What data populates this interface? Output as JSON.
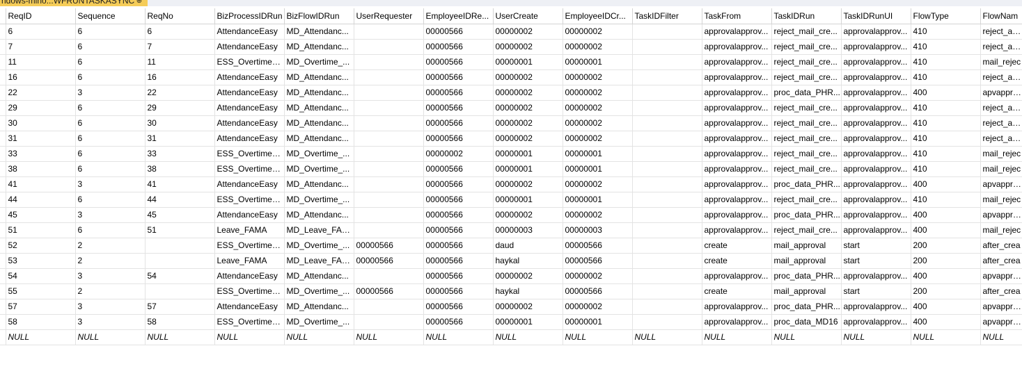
{
  "tab": {
    "title": "ndows-mino...WFRUNTASKASYNC",
    "pin": "⊕ ×"
  },
  "grid": {
    "columns": [
      "ReqID",
      "Sequence",
      "ReqNo",
      "BizProcessIDRun",
      "BizFlowIDRun",
      "UserRequester",
      "EmployeeIDRe...",
      "UserCreate",
      "EmployeeIDCr...",
      "TaskIDFilter",
      "TaskFrom",
      "TaskIDRun",
      "TaskIDRunUI",
      "FlowType",
      "FlowNam"
    ],
    "rows": [
      [
        "6",
        "6",
        "6",
        "AttendanceEasy",
        "MD_Attendanc...",
        "",
        "00000566",
        "00000002",
        "00000002",
        "",
        "approvalapprov...",
        "reject_mail_cre...",
        "approvalapprov...",
        "410",
        "reject_app"
      ],
      [
        "7",
        "6",
        "7",
        "AttendanceEasy",
        "MD_Attendanc...",
        "",
        "00000566",
        "00000002",
        "00000002",
        "",
        "approvalapprov...",
        "reject_mail_cre...",
        "approvalapprov...",
        "410",
        "reject_app"
      ],
      [
        "11",
        "6",
        "11",
        "ESS_Overtime_...",
        "MD_Overtime_...",
        "",
        "00000566",
        "00000001",
        "00000001",
        "",
        "approvalapprov...",
        "reject_mail_cre...",
        "approvalapprov...",
        "410",
        "mail_rejec"
      ],
      [
        "16",
        "6",
        "16",
        "AttendanceEasy",
        "MD_Attendanc...",
        "",
        "00000566",
        "00000002",
        "00000002",
        "",
        "approvalapprov...",
        "reject_mail_cre...",
        "approvalapprov...",
        "410",
        "reject_app"
      ],
      [
        "22",
        "3",
        "22",
        "AttendanceEasy",
        "MD_Attendanc...",
        "",
        "00000566",
        "00000002",
        "00000002",
        "",
        "approvalapprov...",
        "proc_data_PHR...",
        "approvalapprov...",
        "400",
        "apvapprov"
      ],
      [
        "29",
        "6",
        "29",
        "AttendanceEasy",
        "MD_Attendanc...",
        "",
        "00000566",
        "00000002",
        "00000002",
        "",
        "approvalapprov...",
        "reject_mail_cre...",
        "approvalapprov...",
        "410",
        "reject_app"
      ],
      [
        "30",
        "6",
        "30",
        "AttendanceEasy",
        "MD_Attendanc...",
        "",
        "00000566",
        "00000002",
        "00000002",
        "",
        "approvalapprov...",
        "reject_mail_cre...",
        "approvalapprov...",
        "410",
        "reject_app"
      ],
      [
        "31",
        "6",
        "31",
        "AttendanceEasy",
        "MD_Attendanc...",
        "",
        "00000566",
        "00000002",
        "00000002",
        "",
        "approvalapprov...",
        "reject_mail_cre...",
        "approvalapprov...",
        "410",
        "reject_app"
      ],
      [
        "33",
        "6",
        "33",
        "ESS_Overtime_...",
        "MD_Overtime_...",
        "",
        "00000002",
        "00000001",
        "00000001",
        "",
        "approvalapprov...",
        "reject_mail_cre...",
        "approvalapprov...",
        "410",
        "mail_rejec"
      ],
      [
        "38",
        "6",
        "38",
        "ESS_Overtime_...",
        "MD_Overtime_...",
        "",
        "00000566",
        "00000001",
        "00000001",
        "",
        "approvalapprov...",
        "reject_mail_cre...",
        "approvalapprov...",
        "410",
        "mail_rejec"
      ],
      [
        "41",
        "3",
        "41",
        "AttendanceEasy",
        "MD_Attendanc...",
        "",
        "00000566",
        "00000002",
        "00000002",
        "",
        "approvalapprov...",
        "proc_data_PHR...",
        "approvalapprov...",
        "400",
        "apvapprov"
      ],
      [
        "44",
        "6",
        "44",
        "ESS_Overtime_...",
        "MD_Overtime_...",
        "",
        "00000566",
        "00000001",
        "00000001",
        "",
        "approvalapprov...",
        "reject_mail_cre...",
        "approvalapprov...",
        "410",
        "mail_rejec"
      ],
      [
        "45",
        "3",
        "45",
        "AttendanceEasy",
        "MD_Attendanc...",
        "",
        "00000566",
        "00000002",
        "00000002",
        "",
        "approvalapprov...",
        "proc_data_PHR...",
        "approvalapprov...",
        "400",
        "apvapprov"
      ],
      [
        "51",
        "6",
        "51",
        "Leave_FAMA",
        "MD_Leave_FAMA",
        "",
        "00000566",
        "00000003",
        "00000003",
        "",
        "approvalapprov...",
        "reject_mail_cre...",
        "approvalapprov...",
        "400",
        "mail_rejec"
      ],
      [
        "52",
        "2",
        "",
        "ESS_Overtime_...",
        "MD_Overtime_...",
        "00000566",
        "00000566",
        "daud",
        "00000566",
        "",
        "create",
        "mail_approval",
        "start",
        "200",
        "after_crea"
      ],
      [
        "53",
        "2",
        "",
        "Leave_FAMA",
        "MD_Leave_FAMA",
        "00000566",
        "00000566",
        "haykal",
        "00000566",
        "",
        "create",
        "mail_approval",
        "start",
        "200",
        "after_crea"
      ],
      [
        "54",
        "3",
        "54",
        "AttendanceEasy",
        "MD_Attendanc...",
        "",
        "00000566",
        "00000002",
        "00000002",
        "",
        "approvalapprov...",
        "proc_data_PHR...",
        "approvalapprov...",
        "400",
        "apvapprov"
      ],
      [
        "55",
        "2",
        "",
        "ESS_Overtime_...",
        "MD_Overtime_...",
        "00000566",
        "00000566",
        "haykal",
        "00000566",
        "",
        "create",
        "mail_approval",
        "start",
        "200",
        "after_crea"
      ],
      [
        "57",
        "3",
        "57",
        "AttendanceEasy",
        "MD_Attendanc...",
        "",
        "00000566",
        "00000002",
        "00000002",
        "",
        "approvalapprov...",
        "proc_data_PHR...",
        "approvalapprov...",
        "400",
        "apvapprov"
      ],
      [
        "58",
        "3",
        "58",
        "ESS_Overtime_...",
        "MD_Overtime_...",
        "",
        "00000566",
        "00000001",
        "00000001",
        "",
        "approvalapprov...",
        "proc_data_MD16",
        "approvalapprov...",
        "400",
        "apvapprov"
      ]
    ],
    "null_row": [
      "NULL",
      "NULL",
      "NULL",
      "NULL",
      "NULL",
      "NULL",
      "NULL",
      "NULL",
      "NULL",
      "NULL",
      "NULL",
      "NULL",
      "NULL",
      "NULL",
      "NULL"
    ]
  }
}
